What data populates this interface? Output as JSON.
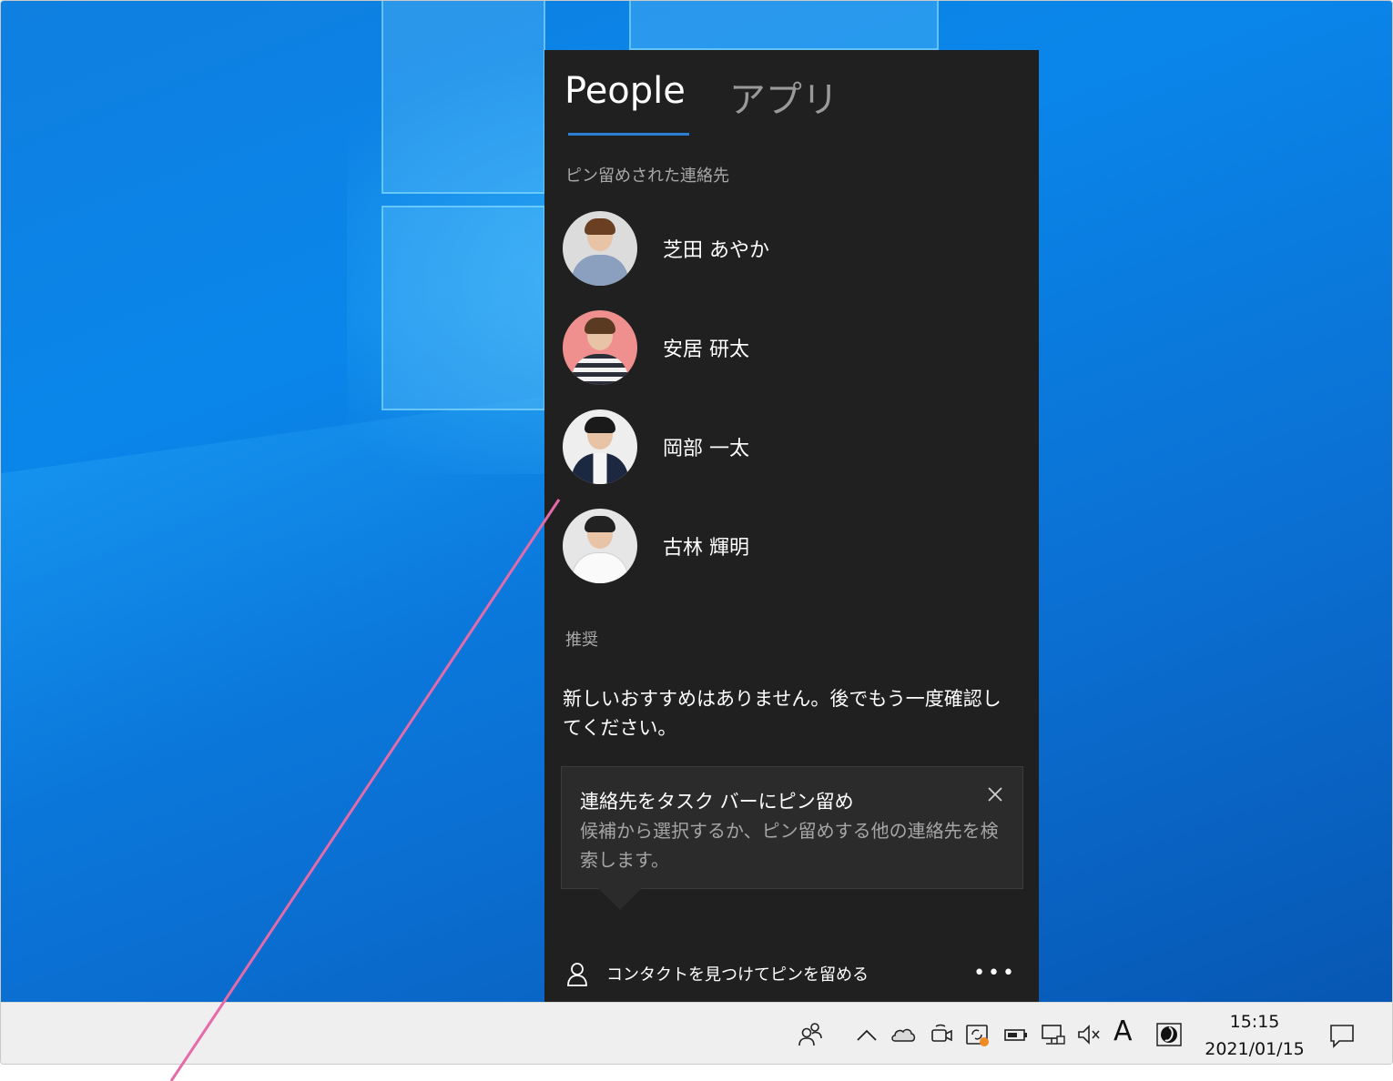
{
  "flyout": {
    "tabs": [
      {
        "label": "People",
        "active": true
      },
      {
        "label": "アプリ",
        "active": false
      }
    ],
    "pinned_section_label": "ピン留めされた連絡先",
    "contacts": [
      {
        "name": "芝田 あやか",
        "avatar_bg": "#dcdcdc"
      },
      {
        "name": "安居 研太",
        "avatar_bg": "#f0908e"
      },
      {
        "name": "岡部 一太",
        "avatar_bg": "#eeeeee"
      },
      {
        "name": "古林 輝明",
        "avatar_bg": "#e6e6e6"
      }
    ],
    "recommended_section_label": "推奨",
    "recommended_empty_text": "新しいおすすめはありません。後でもう一度確認してください。",
    "tip": {
      "title": "連絡先をタスク バーにピン留め",
      "body": "候補から選択するか、ピン留めする他の連絡先を検索します。",
      "close_icon": "close-icon"
    },
    "footer": {
      "icon": "person-icon",
      "label": "コンタクトを見つけてピンを留める",
      "more_label": "•••"
    }
  },
  "taskbar": {
    "tray_icons": [
      "people-icon",
      "chevron-up-icon",
      "onedrive-cloud-icon",
      "meet-now-icon",
      "sync-alert-icon",
      "battery-icon",
      "network-icon",
      "volume-muted-icon",
      "ime-icon",
      "night-light-icon"
    ],
    "ime_label": "A",
    "clock": {
      "time": "15:15",
      "date": "2021/01/15"
    },
    "notification_icon": "action-center-icon"
  },
  "colors": {
    "flyout_bg": "#202020",
    "accent": "#2b7fd4",
    "taskbar_bg": "#efefef",
    "desktop_blue": "#0b78dc",
    "callout_line": "#e46aa8",
    "status_dot": "#f08a24"
  }
}
